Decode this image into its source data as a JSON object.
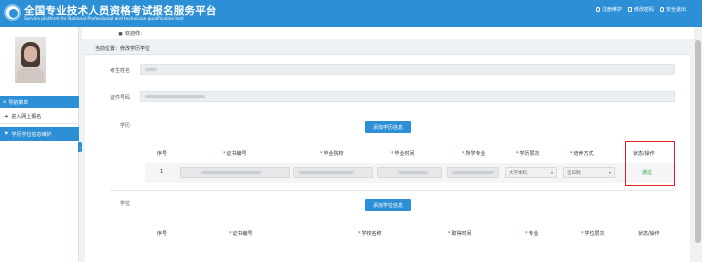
{
  "header": {
    "title_cn": "全国专业技术人员资格考试报名服务平台",
    "title_en": "Service platform for National Professional and technician qualification test",
    "links": [
      {
        "label": "注册维护",
        "icon": "info-icon"
      },
      {
        "label": "修改密码",
        "icon": "edit-icon"
      },
      {
        "label": "安全退出",
        "icon": "power-icon"
      }
    ]
  },
  "sidebar": {
    "nav_header": "导航菜单",
    "items": [
      {
        "label": "进入网上报名",
        "icon": "login-icon"
      },
      {
        "label": "学历学位信息维护",
        "icon": "flag-icon",
        "active": true
      }
    ],
    "collapse_icon": "chevron-left-icon"
  },
  "topbar": {
    "welcome": "欢迎你：",
    "breadcrumb": "当前位置：修改学历学位"
  },
  "form": {
    "name_label": "考生姓名",
    "id_label": "证件号码",
    "education_label": "学历",
    "degree_label": "学位",
    "add_education_button": "添加学历信息",
    "add_degree_button": "添加学位信息"
  },
  "education_table": {
    "headers": [
      {
        "label": "序号",
        "required": false
      },
      {
        "label": "证书编号",
        "required": true
      },
      {
        "label": "毕业院校",
        "required": true
      },
      {
        "label": "毕业时间",
        "required": true
      },
      {
        "label": "所学专业",
        "required": true
      },
      {
        "label": "学历层次",
        "required": true
      },
      {
        "label": "培养方式",
        "required": true
      },
      {
        "label": "状态/操作",
        "required": false
      }
    ],
    "rows": [
      {
        "index": "1",
        "level": "大学本科",
        "mode": "全日制",
        "status": "通过"
      }
    ]
  },
  "degree_table": {
    "headers": [
      {
        "label": "序号",
        "required": false
      },
      {
        "label": "证书编号",
        "required": true
      },
      {
        "label": "学校名称",
        "required": true
      },
      {
        "label": "取得时间",
        "required": true
      },
      {
        "label": "专业",
        "required": true
      },
      {
        "label": "学位层次",
        "required": true
      },
      {
        "label": "状态/操作",
        "required": false
      }
    ]
  },
  "colors": {
    "primary": "#2d8fd6",
    "pass": "#22a84a",
    "highlight": "#e02020"
  }
}
